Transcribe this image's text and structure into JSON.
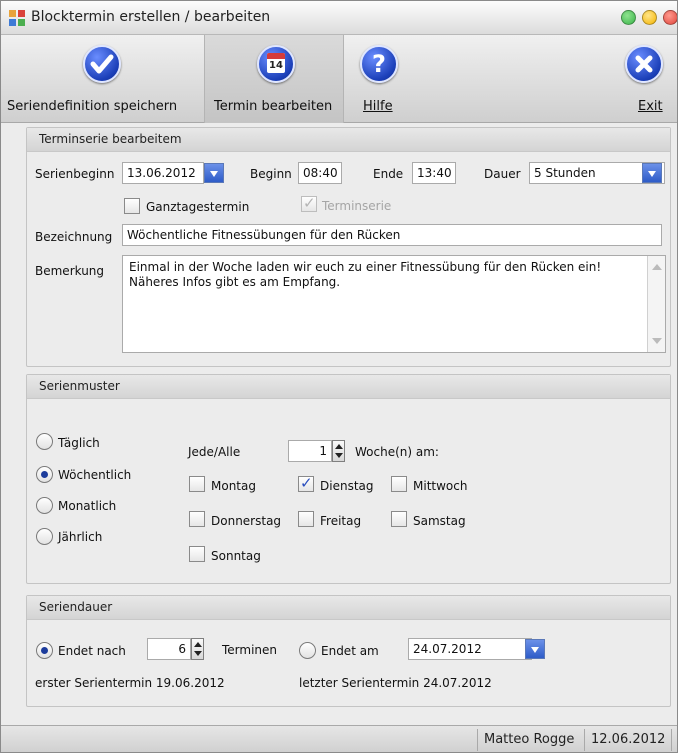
{
  "window": {
    "title": "Blocktermin erstellen / bearbeiten",
    "controls": {
      "minimize_color": "#3bb54a",
      "maximize_color": "#f4b400",
      "close_color": "#e0443a"
    }
  },
  "toolbar": {
    "buttons": [
      {
        "label": "Seriendefinition  speichern",
        "icon": "checkmark-icon",
        "active": false
      },
      {
        "label": "Termin bearbeiten",
        "icon": "calendar-icon",
        "active": true
      },
      {
        "label": "Hilfe",
        "icon": "help-icon",
        "active": false
      },
      {
        "label": "Exit",
        "icon": "close-icon",
        "active": false
      }
    ],
    "calendar_icon_day": "14",
    "help_glyph": "?"
  },
  "terminserie": {
    "header": "Terminserie bearbeitem",
    "serienbeginn_label": "Serienbeginn",
    "serienbeginn_value": "13.06.2012",
    "beginn_label": "Beginn",
    "beginn_value": "08:40",
    "ende_label": "Ende",
    "ende_value": "13:40",
    "dauer_label": "Dauer",
    "dauer_value": "5 Stunden",
    "ganztagestermin_label": "Ganztagestermin",
    "ganztagestermin_checked": false,
    "terminserie_label": "Terminserie",
    "terminserie_checked": true,
    "bezeichnung_label": "Bezeichnung",
    "bezeichnung_value": "Wöchentliche Fitnessübungen für den Rücken",
    "bemerkung_label": "Bemerkung",
    "bemerkung_line1": "Einmal in der Woche laden wir euch zu einer Fitnessübung für den Rücken ein!",
    "bemerkung_line2": "Näheres Infos gibt es am Empfang."
  },
  "serienmuster": {
    "header": "Serienmuster",
    "options": [
      "Täglich",
      "Wöchentlich",
      "Monatlich",
      "Jährlich"
    ],
    "selected": "Wöchentlich",
    "jede_label": "Jede/Alle",
    "interval_value": "1",
    "woche_label": "Woche(n) am:",
    "days": [
      {
        "label": "Montag",
        "checked": false
      },
      {
        "label": "Dienstag",
        "checked": true
      },
      {
        "label": "Mittwoch",
        "checked": false
      },
      {
        "label": "Donnerstag",
        "checked": false
      },
      {
        "label": "Freitag",
        "checked": false
      },
      {
        "label": "Samstag",
        "checked": false
      },
      {
        "label": "Sonntag",
        "checked": false
      }
    ]
  },
  "seriendauer": {
    "header": "Seriendauer",
    "endet_nach_label": "Endet nach",
    "endet_nach_selected": true,
    "count_value": "6",
    "terminen_label": "Terminen",
    "endet_am_label": "Endet am",
    "endet_am_selected": false,
    "endet_am_value": "24.07.2012",
    "erster_termin": "erster Serientermin 19.06.2012",
    "letzter_termin": "letzter Serientermin 24.07.2012"
  },
  "statusbar": {
    "user": "Matteo Rogge",
    "date": "12.06.2012"
  }
}
